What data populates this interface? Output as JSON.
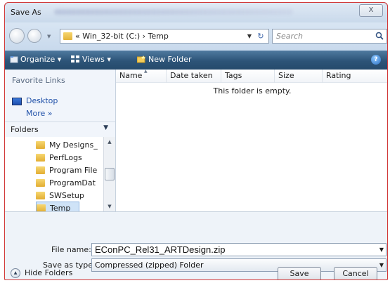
{
  "window": {
    "title": "Save As",
    "close_symbol": "X"
  },
  "address_bar": {
    "path_text": "« Win_32-bit (C:) › Temp",
    "refresh_symbol": "↻"
  },
  "search": {
    "placeholder": "Search"
  },
  "toolbar": {
    "organize_label": "Organize ▾",
    "views_label": "Views ▾",
    "new_folder_label": "New Folder",
    "help_symbol": "?"
  },
  "nav": {
    "favorites_heading": "Favorite Links",
    "favorites": [
      {
        "label": "Desktop"
      },
      {
        "label": "More »"
      }
    ],
    "folders_heading": "Folders",
    "tree": [
      {
        "label": "My Designs_"
      },
      {
        "label": "PerfLogs"
      },
      {
        "label": "Program File"
      },
      {
        "label": "ProgramDat"
      },
      {
        "label": "SWSetup"
      },
      {
        "label": "Temp"
      }
    ],
    "selected": "Temp"
  },
  "file_list": {
    "columns": [
      "Name",
      "Date taken",
      "Tags",
      "Size",
      "Rating"
    ],
    "empty_message": "This folder is empty."
  },
  "form": {
    "file_name_label": "File name:",
    "file_name_value": "EConPC_Rel31_ARTDesign.zip",
    "save_as_type_label": "Save as type:",
    "save_as_type_value": "Compressed (zipped) Folder"
  },
  "footer": {
    "hide_folders_label": "Hide Folders",
    "save_label": "Save",
    "cancel_label": "Cancel"
  }
}
